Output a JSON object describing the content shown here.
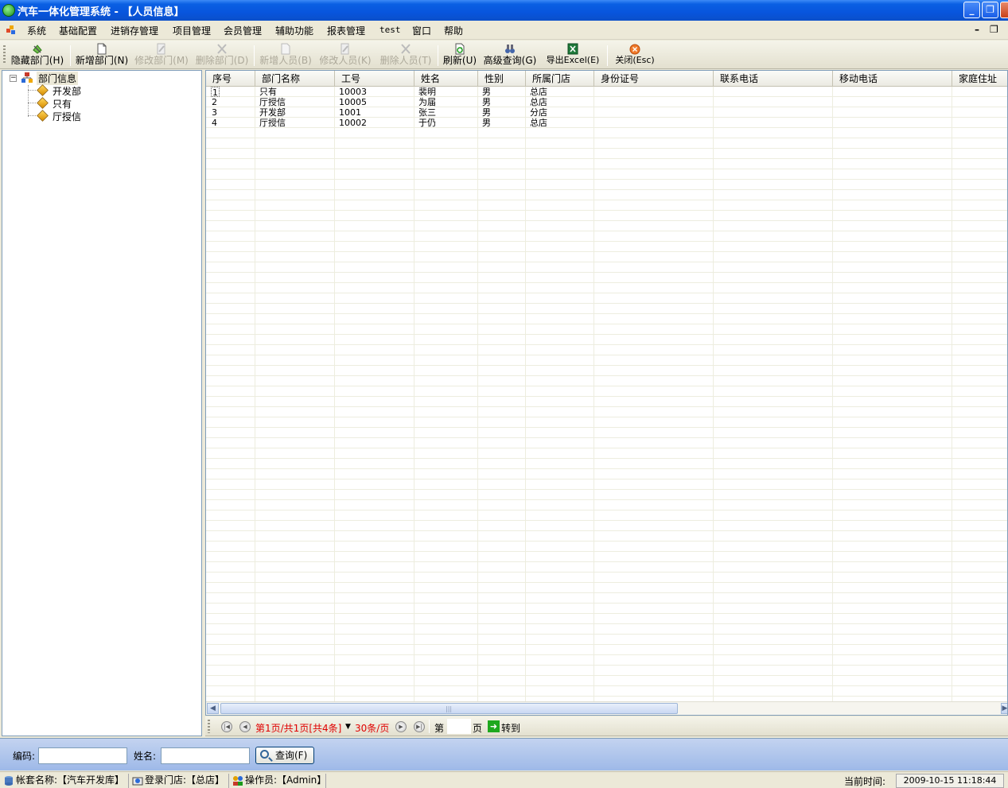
{
  "window": {
    "title": "汽车一体化管理系统 - 【人员信息】",
    "minimize": "_",
    "restore": "❐",
    "close": "✕"
  },
  "menu": {
    "items": [
      "系统",
      "基础配置",
      "进销存管理",
      "项目管理",
      "会员管理",
      "辅助功能",
      "报表管理",
      "test",
      "窗口",
      "帮助"
    ],
    "mdi_minimize": "–",
    "mdi_restore": "❐"
  },
  "toolbar": {
    "hide_dept": "隐藏部门(H)",
    "add_dept": "新增部门(N)",
    "edit_dept": "修改部门(M)",
    "delete_dept": "删除部门(D)",
    "add_person": "新增人员(B)",
    "edit_person": "修改人员(K)",
    "delete_person": "删除人员(T)",
    "refresh": "刷新(U)",
    "advanced_query": "高级查询(G)",
    "export_excel": "导出Excel(E)",
    "close": "关闭(Esc)"
  },
  "tree": {
    "root": "部门信息",
    "expander": "−",
    "children": [
      "开发部",
      "只有",
      "厅授信"
    ]
  },
  "grid": {
    "columns": [
      "序号",
      "部门名称",
      "工号",
      "姓名",
      "性别",
      "所属门店",
      "身份证号",
      "联系电话",
      "移动电话",
      "家庭住址"
    ],
    "rows": [
      [
        "1",
        "只有",
        "10003",
        "裴明",
        "男",
        "总店",
        "",
        "",
        "",
        ""
      ],
      [
        "2",
        "厅授信",
        "10005",
        "为届",
        "男",
        "总店",
        "",
        "",
        "",
        ""
      ],
      [
        "3",
        "开发部",
        "1001",
        "张三",
        "男",
        "分店",
        "",
        "",
        "",
        ""
      ],
      [
        "4",
        "厅授信",
        "10002",
        "于仍",
        "男",
        "总店",
        "",
        "",
        "",
        ""
      ]
    ]
  },
  "pager": {
    "page_info": "第1页/共1页[共4条]",
    "per_page": "30条/页",
    "page_prefix": "第",
    "page_suffix": "页",
    "goto": "转到",
    "page_value": ""
  },
  "search": {
    "code_label": "编码:",
    "code_value": "",
    "name_label": "姓名:",
    "name_value": "",
    "query_button": "查询(F)"
  },
  "status": {
    "account": "帐套名称:【汽车开发库】",
    "store": "登录门店:【总店】",
    "operator": "操作员:【Admin】",
    "time_label": "当前时间:",
    "time_value": "2009-10-15 11:18:44"
  },
  "colors": {
    "titlebar": "#0855dd",
    "pager_red": "#e00000",
    "search_panel": "#9eb9e8"
  }
}
